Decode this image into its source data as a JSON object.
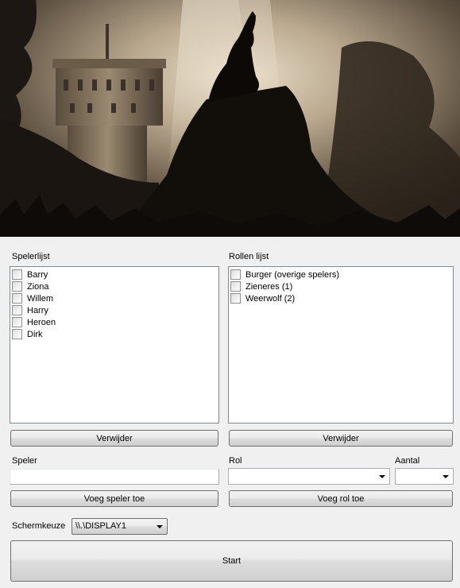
{
  "players": {
    "label": "Spelerlijst",
    "items": [
      "Barry",
      "Ziona",
      "Willem",
      "Harry",
      "Heroen",
      "Dirk"
    ],
    "remove_label": "Verwijder"
  },
  "roles": {
    "label": "Rollen lijst",
    "items": [
      "Burger (overige spelers)",
      "Zieneres (1)",
      "Weerwolf (2)"
    ],
    "remove_label": "Verwijder"
  },
  "add_player": {
    "field_label": "Speler",
    "value": "",
    "button_label": "Voeg speler toe"
  },
  "add_role": {
    "role_label": "Rol",
    "role_value": "",
    "count_label": "Aantal",
    "count_value": "",
    "button_label": "Voeg rol toe"
  },
  "screen": {
    "label": "Schermkeuze",
    "selected": "\\\\.\\DISPLAY1"
  },
  "start_label": "Start",
  "icons": {
    "dropdown": "chevron-down-icon",
    "checkbox": "checkbox-icon"
  },
  "colors": {
    "window_bg": "#f0f0f0",
    "banner_sepia": "#7a6a55",
    "border": "#828790"
  }
}
